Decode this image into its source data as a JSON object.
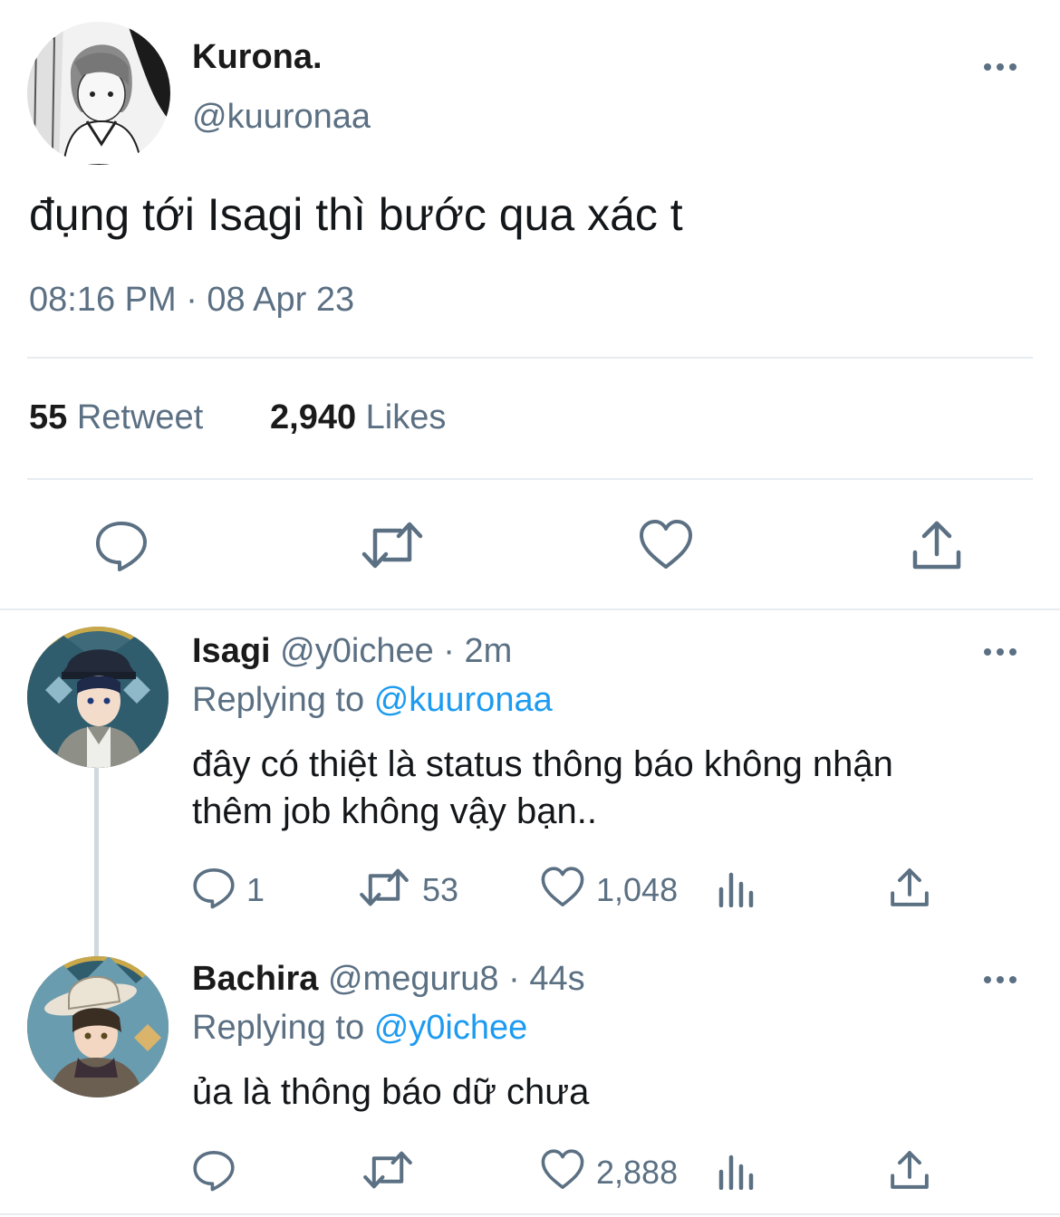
{
  "main_tweet": {
    "display_name": "Kurona.",
    "handle": "@kuuronaa",
    "text": "đụng tới Isagi thì bước qua xác t",
    "timestamp": "08:16 PM · 08 Apr 23",
    "retweet_count": "55",
    "retweet_label": "Retweet",
    "like_count": "2,940",
    "like_label": "Likes"
  },
  "replies": [
    {
      "display_name": "Isagi",
      "handle": "@y0ichee",
      "separator": "·",
      "time": "2m",
      "replying_prefix": "Replying to",
      "replying_to": "@kuuronaa",
      "text_line1": "đây có thiệt là status thông báo không nhận",
      "text_line2": "thêm job không vậy bạn..",
      "reply_count": "1",
      "retweet_count": "53",
      "like_count": "1,048"
    },
    {
      "display_name": "Bachira",
      "handle": "@meguru8",
      "separator": "·",
      "time": "44s",
      "replying_prefix": "Replying to",
      "replying_to": "@y0ichee",
      "text_line1": "ủa là thông báo dữ chưa",
      "like_count": "2,888"
    }
  ],
  "colors": {
    "accent": "#1d9bf0",
    "secondary_text": "#5b7083",
    "divider": "#e6ecf0"
  },
  "icons": [
    "more-icon",
    "reply-icon",
    "retweet-icon",
    "like-icon",
    "share-icon",
    "analytics-icon"
  ]
}
